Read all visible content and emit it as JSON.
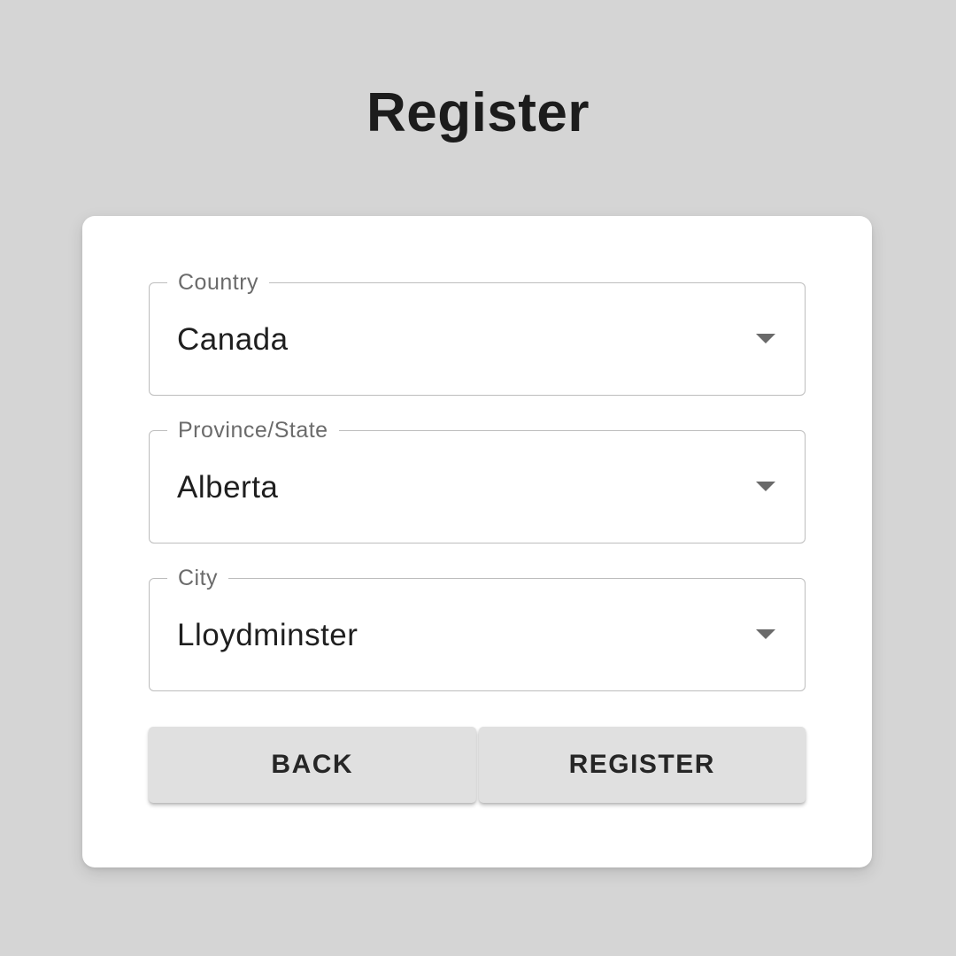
{
  "page": {
    "title": "Register"
  },
  "form": {
    "fields": [
      {
        "label": "Country",
        "value": "Canada",
        "icon": "caret-down-icon"
      },
      {
        "label": "Province/State",
        "value": "Alberta",
        "icon": "caret-down-icon"
      },
      {
        "label": "City",
        "value": "Lloydminster",
        "icon": "caret-down-icon"
      }
    ],
    "buttons": {
      "back_label": "BACK",
      "register_label": "REGISTER"
    }
  },
  "colors": {
    "background": "#d5d5d5",
    "card": "#ffffff",
    "button": "#e0e0e0",
    "text": "#1c1c1c"
  }
}
